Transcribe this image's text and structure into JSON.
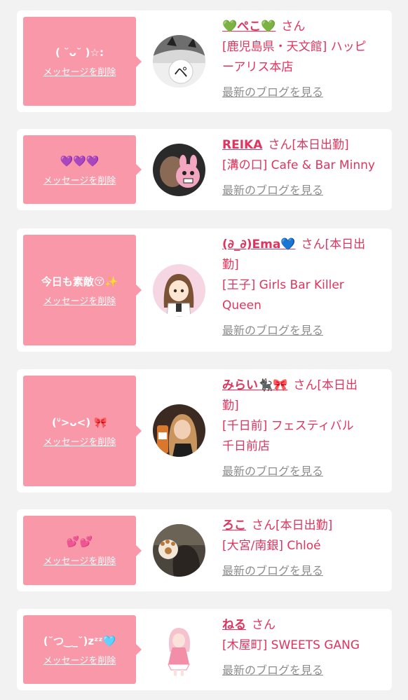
{
  "colors": {
    "accent": "#e0345e",
    "bubble": "#f898a8",
    "link_gray": "#8e8e8e",
    "background": "#f2f2f2"
  },
  "delete_label": "メッセージを削除",
  "blog_label": "最新のブログを見る",
  "san_suffix": "さん",
  "entries": [
    {
      "message": "( ˘ᴗ˘ )☆:",
      "name": "💚ぺこ💚",
      "status": "",
      "shop_lines": [
        "[鹿児島県・天文館] ハッピ",
        "ーアリス本店"
      ]
    },
    {
      "message": "💜💜💜",
      "name": "REIKA",
      "status": "[本日出勤]",
      "shop_lines": [
        "[溝の口] Cafe & Bar Minny"
      ]
    },
    {
      "message": "今日も素敵😚✨",
      "name": "(∂_∂)Ema💙",
      "status": "[本日出",
      "status2": "勤]",
      "shop_lines": [
        "[王子] Girls Bar Killer",
        "Queen"
      ]
    },
    {
      "message": "(ᐡ>ᴗ<) 🎀",
      "name": "みらい🐈‍⬛🎀",
      "status": "[本日出",
      "status2": "勤]",
      "shop_lines": [
        "[千日前] フェスティバル",
        "千日前店"
      ]
    },
    {
      "message": "💕💕",
      "name": "ろこ",
      "status": "[本日出勤]",
      "shop_lines": [
        "[大宮/南銀] Chloé"
      ]
    },
    {
      "message": "(˘つ‿_˘)zᶻᶻ🩵",
      "name": "ねる",
      "status": "",
      "shop_lines": [
        "[木屋町] SWEETS GANG"
      ]
    }
  ]
}
